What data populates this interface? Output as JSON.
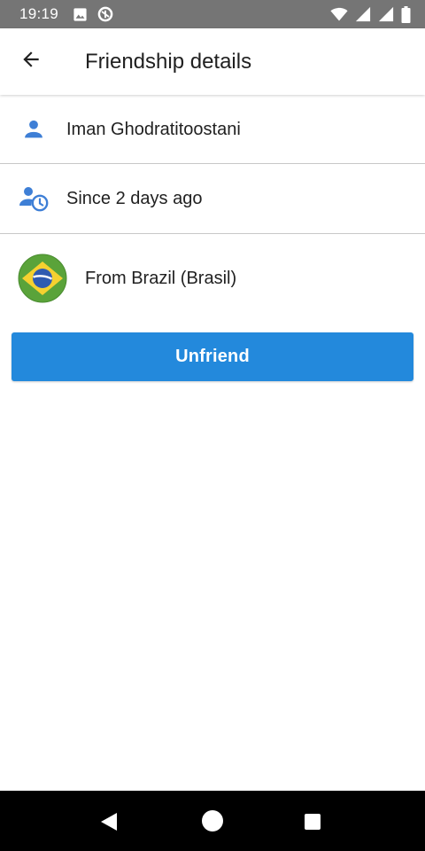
{
  "status_bar": {
    "time": "19:19",
    "icons": [
      "image-icon",
      "data-saver-icon",
      "wifi-icon",
      "signal-icon",
      "signal-icon",
      "battery-icon"
    ]
  },
  "app_bar": {
    "title": "Friendship details",
    "back_icon": "arrow-back-icon"
  },
  "details": {
    "name": "Iman Ghodratitoostani",
    "name_icon": "person-icon",
    "since": "Since 2 days ago",
    "since_icon": "person-clock-icon",
    "country": "From Brazil (Brasil)",
    "country_flag": "brazil-flag-icon"
  },
  "actions": {
    "unfriend_label": "Unfriend"
  },
  "colors": {
    "accent": "#2389dc",
    "icon_blue": "#3e7fd6",
    "status_bar": "#757575",
    "nav_bar": "#000000"
  },
  "nav_bar": {
    "icons": [
      "nav-back-icon",
      "nav-home-icon",
      "nav-recents-icon"
    ]
  }
}
